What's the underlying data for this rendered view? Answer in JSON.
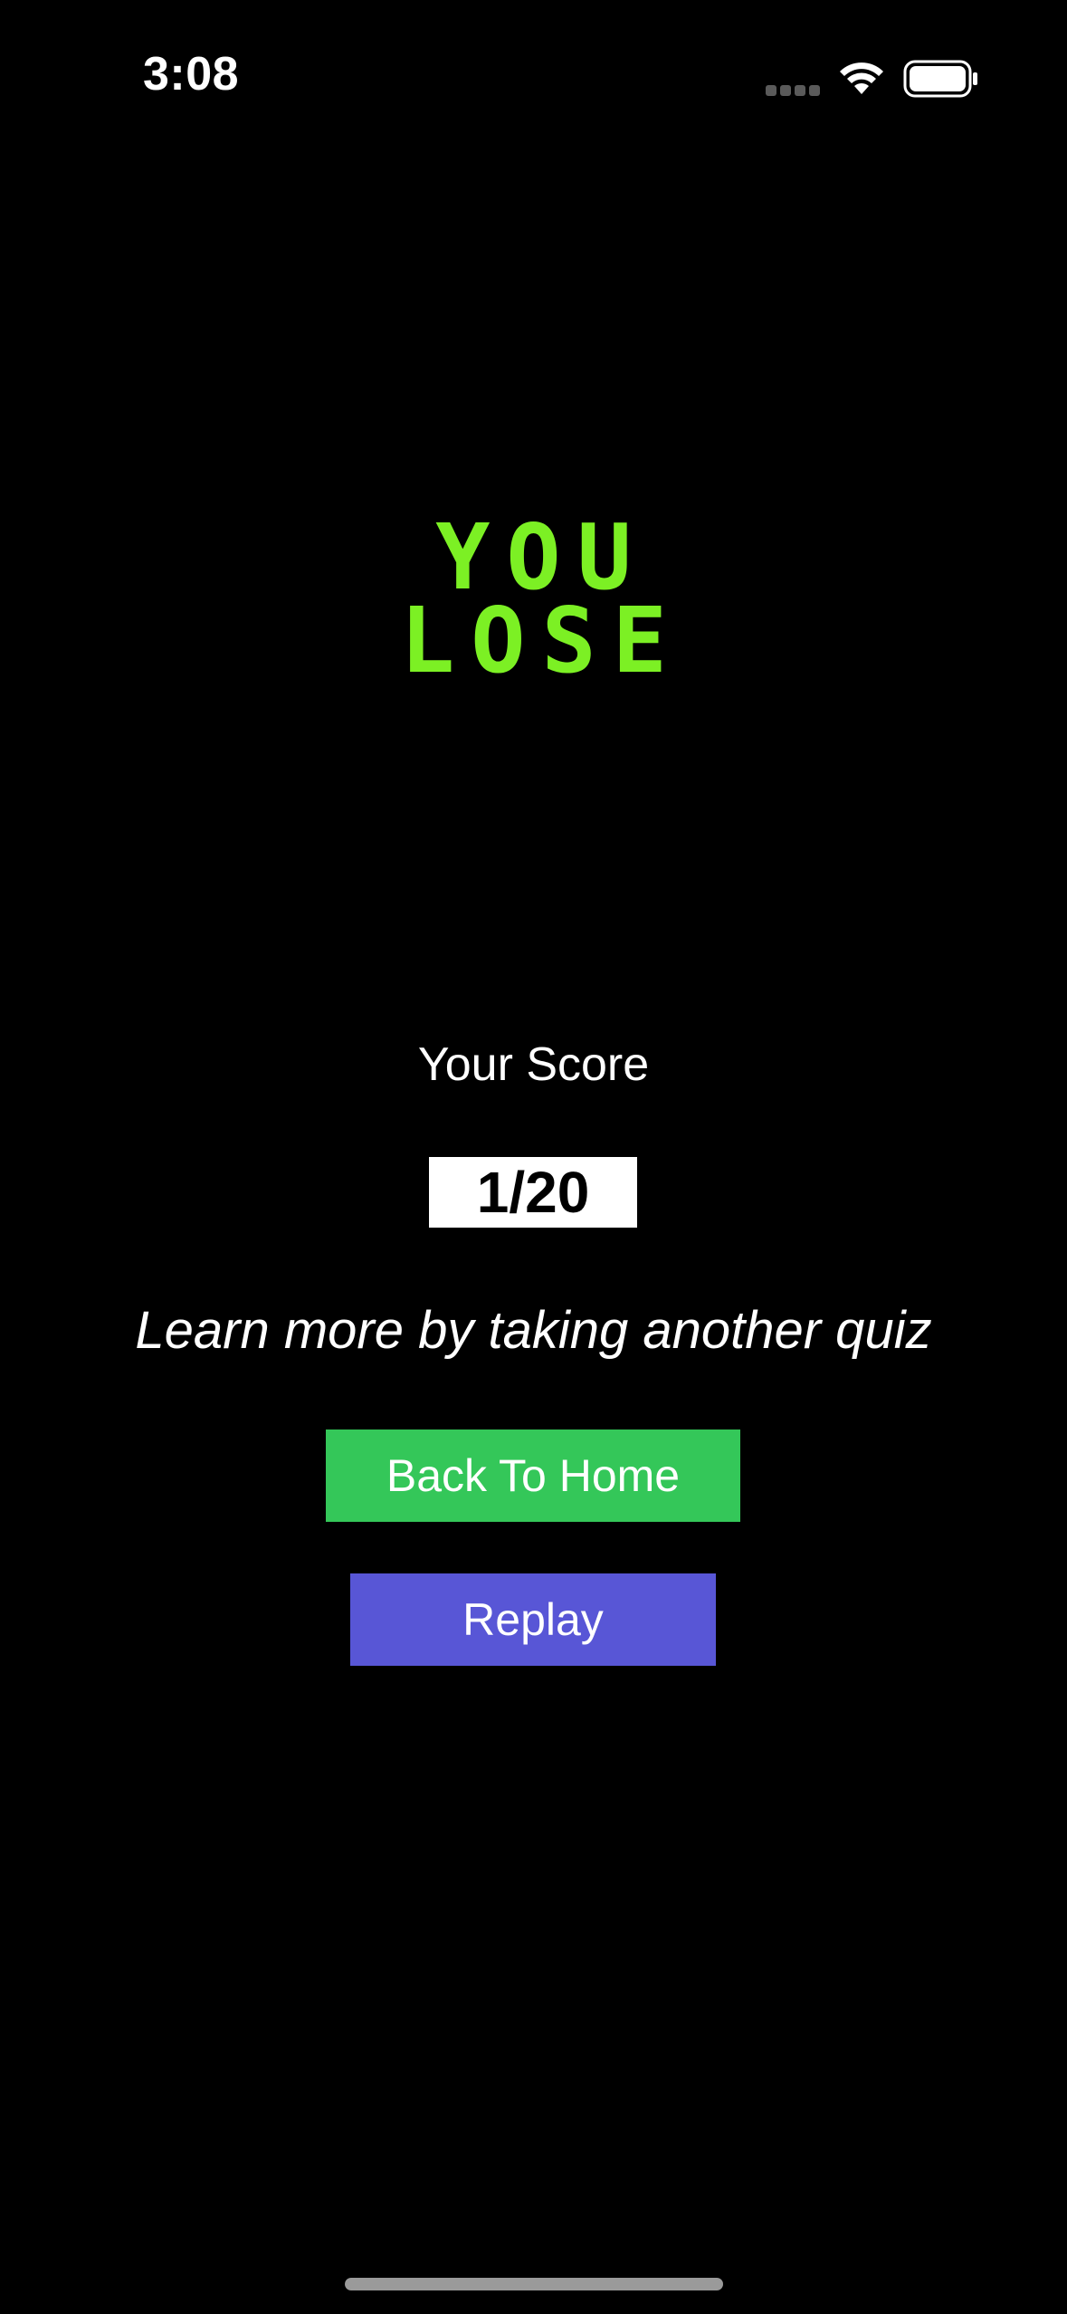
{
  "status_bar": {
    "time": "3:08",
    "icons": [
      "signal-dots-icon",
      "wifi-icon",
      "battery-icon"
    ]
  },
  "result": {
    "title_line1": "YOU",
    "title_line2": "LOSE",
    "title_color": "#7cf024"
  },
  "score": {
    "label": "Your Score",
    "value": "1/20"
  },
  "message": "Learn more by taking another quiz",
  "buttons": {
    "home_label": "Back To Home",
    "home_color": "#34c759",
    "replay_label": "Replay",
    "replay_color": "#5856d6"
  }
}
